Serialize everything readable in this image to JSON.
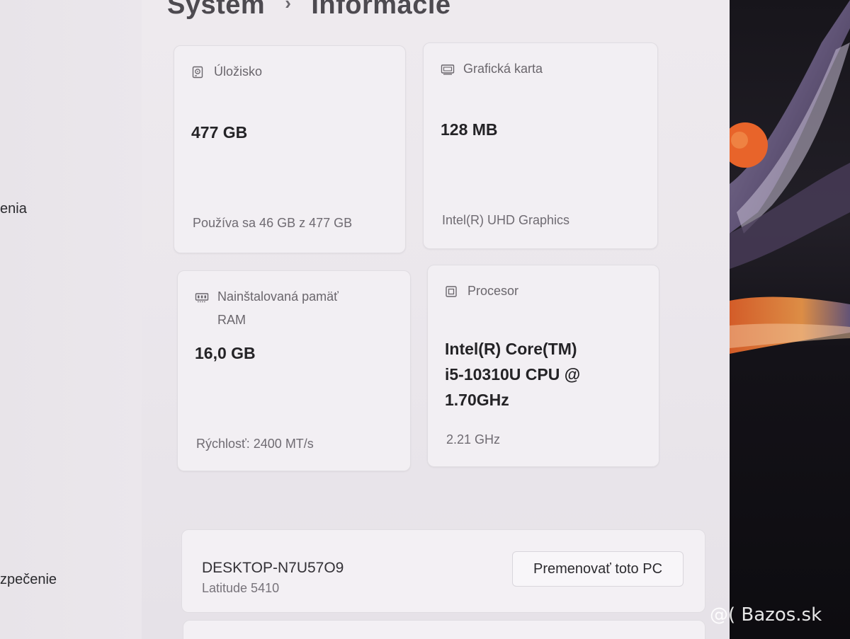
{
  "breadcrumb": {
    "parent": "Systém",
    "separator": "›",
    "current": "Informácie"
  },
  "sidebar": {
    "items": [
      {
        "label": "enia"
      },
      {
        "label": "zpečenie"
      }
    ]
  },
  "specs": {
    "storage": {
      "icon": "storage-icon",
      "title": "Úložisko",
      "value": "477 GB",
      "detail": "Používa sa 46 GB z 477 GB"
    },
    "graphics": {
      "icon": "graphics-card-icon",
      "title": "Grafická karta",
      "value": "128 MB",
      "detail": "Intel(R) UHD Graphics"
    },
    "ram": {
      "icon": "memory-icon",
      "title_line1": "Nainštalovaná pamäť",
      "title_line2": "RAM",
      "value": "16,0 GB",
      "detail": "Rýchlosť: 2400 MT/s"
    },
    "processor": {
      "icon": "processor-icon",
      "title": "Procesor",
      "value_line1": "Intel(R) Core(TM)",
      "value_line2": "i5-10310U CPU @",
      "value_line3": "1.70GHz",
      "detail": "2.21 GHz"
    }
  },
  "device": {
    "name": "DESKTOP-N7U57O9",
    "model": "Latitude 5410",
    "rename_label": "Premenovať toto PC"
  },
  "watermark": "@( Bazos.sk",
  "colors": {
    "window_bg": "#ebe7ec",
    "card_bg": "#f2eff3",
    "text_primary": "#242326",
    "text_secondary": "#6f6b72",
    "wallpaper_orange": "#e8642a"
  }
}
